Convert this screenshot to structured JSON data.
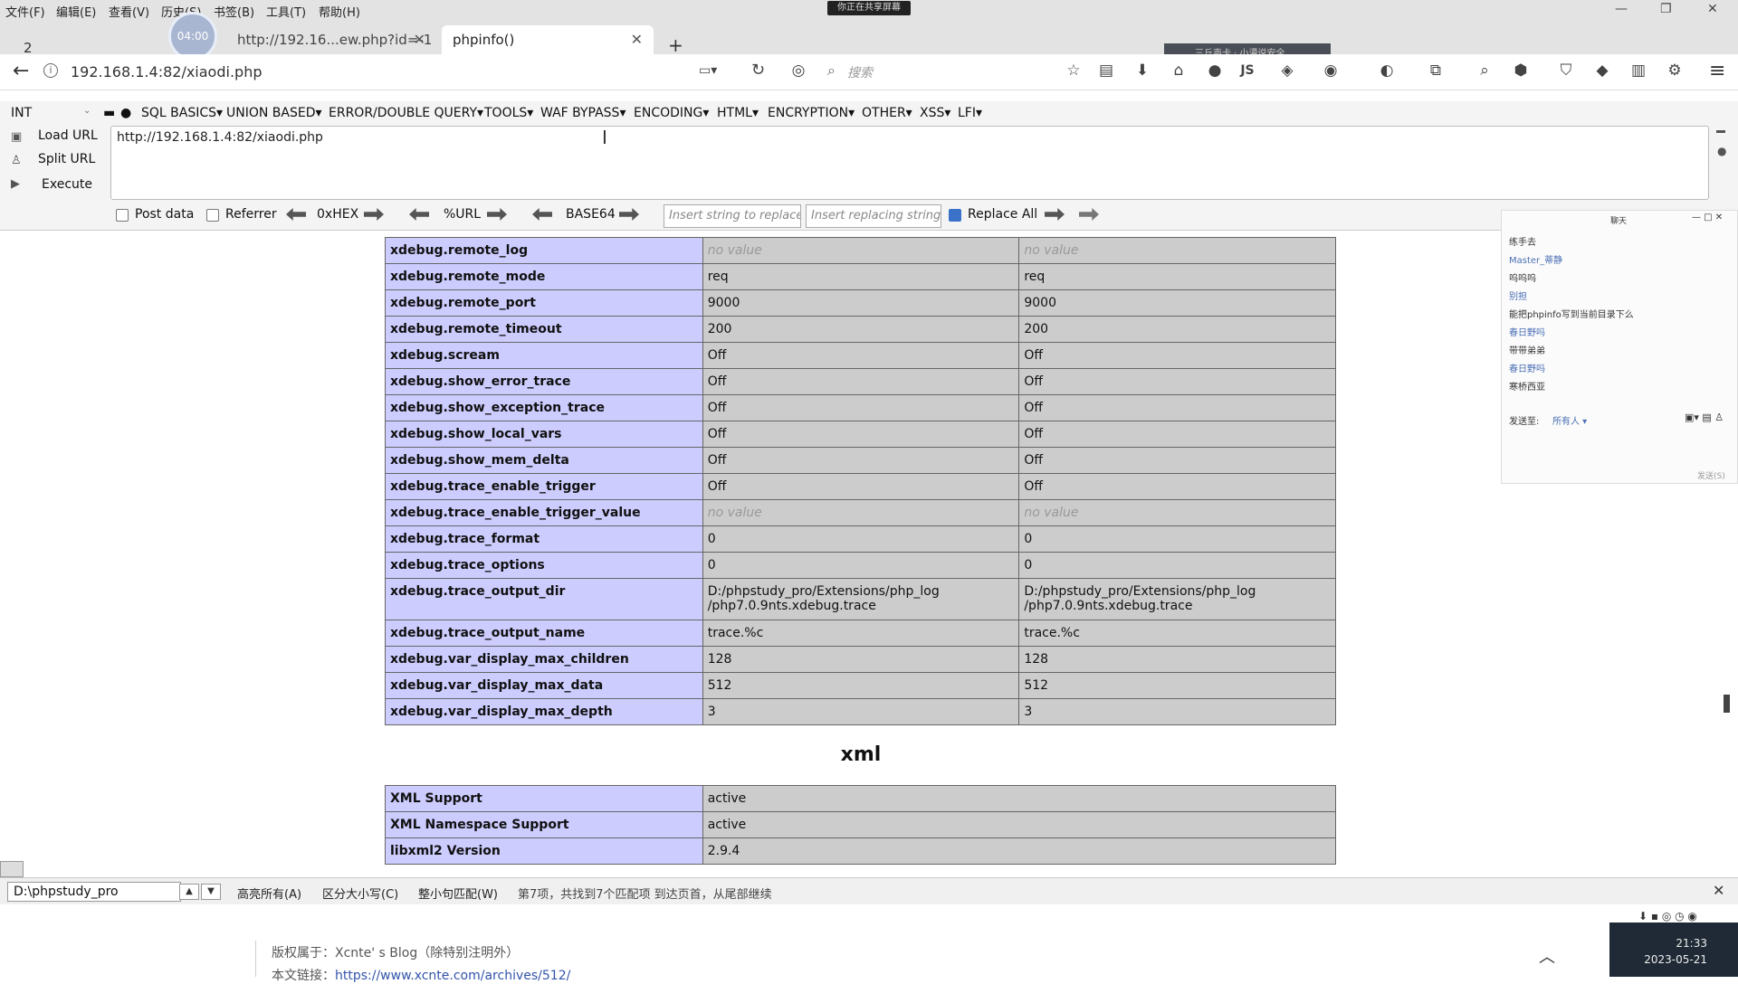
{
  "menubar": {
    "items": [
      "文件(F)",
      "编辑(E)",
      "查看(V)",
      "历史(S)",
      "书签(B)",
      "工具(T)",
      "帮助(H)"
    ],
    "share_badge": "你正在共享屏幕"
  },
  "overlay": {
    "timer": "04:00",
    "tab_count": "2",
    "banner": "三丘声卡 · 小漫说安全"
  },
  "tabs": [
    {
      "title": "http://192.16...ew.php?id=-1",
      "close": "✕"
    },
    {
      "title": "phpinfo()",
      "close": "✕"
    }
  ],
  "new_tab": "+",
  "address_bar": {
    "url": "192.168.1.4:82/xiaodi.php",
    "search_placeholder": "搜索"
  },
  "toolbar_icons": {
    "js_label": "JS"
  },
  "hackbar": {
    "type_select": "INT",
    "menus": [
      "SQL BASICS▾",
      "UNION BASED▾",
      "ERROR/DOUBLE QUERY▾",
      "TOOLS▾",
      "WAF BYPASS▾",
      "ENCODING▾",
      "HTML▾",
      "ENCRYPTION▾",
      "OTHER▾",
      "XSS▾",
      "LFI▾"
    ],
    "side": [
      "Load URL",
      "Split URL",
      "Execute"
    ],
    "url_value": "http://192.168.1.4:82/xiaodi.php",
    "post_data": {
      "label": "Post data",
      "checked": false
    },
    "referrer": {
      "label": "Referrer",
      "checked": false
    },
    "encoders": [
      "0xHEX",
      "%URL",
      "BASE64"
    ],
    "insert_string_placeholder": "Insert string to replace",
    "insert_replacing_placeholder": "Insert replacing string",
    "replace_all": {
      "label": "Replace All",
      "checked": true
    }
  },
  "xdebug_rows": [
    {
      "name": "xdebug.remote_log",
      "local": "no value",
      "master": "no value",
      "novalue": true
    },
    {
      "name": "xdebug.remote_mode",
      "local": "req",
      "master": "req"
    },
    {
      "name": "xdebug.remote_port",
      "local": "9000",
      "master": "9000"
    },
    {
      "name": "xdebug.remote_timeout",
      "local": "200",
      "master": "200"
    },
    {
      "name": "xdebug.scream",
      "local": "Off",
      "master": "Off"
    },
    {
      "name": "xdebug.show_error_trace",
      "local": "Off",
      "master": "Off"
    },
    {
      "name": "xdebug.show_exception_trace",
      "local": "Off",
      "master": "Off"
    },
    {
      "name": "xdebug.show_local_vars",
      "local": "Off",
      "master": "Off"
    },
    {
      "name": "xdebug.show_mem_delta",
      "local": "Off",
      "master": "Off"
    },
    {
      "name": "xdebug.trace_enable_trigger",
      "local": "Off",
      "master": "Off"
    },
    {
      "name": "xdebug.trace_enable_trigger_value",
      "local": "no value",
      "master": "no value",
      "novalue": true
    },
    {
      "name": "xdebug.trace_format",
      "local": "0",
      "master": "0"
    },
    {
      "name": "xdebug.trace_options",
      "local": "0",
      "master": "0"
    },
    {
      "name": "xdebug.trace_output_dir",
      "local": "D:/phpstudy_pro/Extensions/php_log /php7.0.9nts.xdebug.trace",
      "master": "D:/phpstudy_pro/Extensions/php_log /php7.0.9nts.xdebug.trace",
      "tall": true
    },
    {
      "name": "xdebug.trace_output_name",
      "local": "trace.%c",
      "master": "trace.%c"
    },
    {
      "name": "xdebug.var_display_max_children",
      "local": "128",
      "master": "128"
    },
    {
      "name": "xdebug.var_display_max_data",
      "local": "512",
      "master": "512"
    },
    {
      "name": "xdebug.var_display_max_depth",
      "local": "3",
      "master": "3"
    }
  ],
  "xml_section": {
    "title": "xml",
    "rows": [
      {
        "name": "XML Support",
        "value": "active"
      },
      {
        "name": "XML Namespace Support",
        "value": "active"
      },
      {
        "name": "libxml2 Version",
        "value": "2.9.4"
      }
    ]
  },
  "chat": {
    "title": "聊天",
    "messages": [
      "练手去",
      "Master_蒂静",
      "呜呜呜",
      "别担",
      "能把phpinfo写到当前目录下么",
      "春日野吗",
      "带带弟弟",
      "春日野吗",
      "寒桥西亚"
    ],
    "send_to_label": "发送至:",
    "send_to_value": "所有人 ▾",
    "send_button": "发送(S)"
  },
  "findbar": {
    "value": "D:\\phpstudy_pro",
    "options": [
      "高亮所有(A)",
      "区分大小写(C)",
      "整小句匹配(W)"
    ],
    "status": "第7项，共找到7个匹配项   到达页首，从尾部继续",
    "close": "✕"
  },
  "footer": {
    "copyright": "版权属于：Xcnte' s Blog（除特别注明外）",
    "permalink_label": "本文链接：",
    "permalink_url": "https://www.xcnte.com/archives/512/"
  },
  "taskbar": {
    "time": "21:33",
    "date": "2023-05-21"
  }
}
